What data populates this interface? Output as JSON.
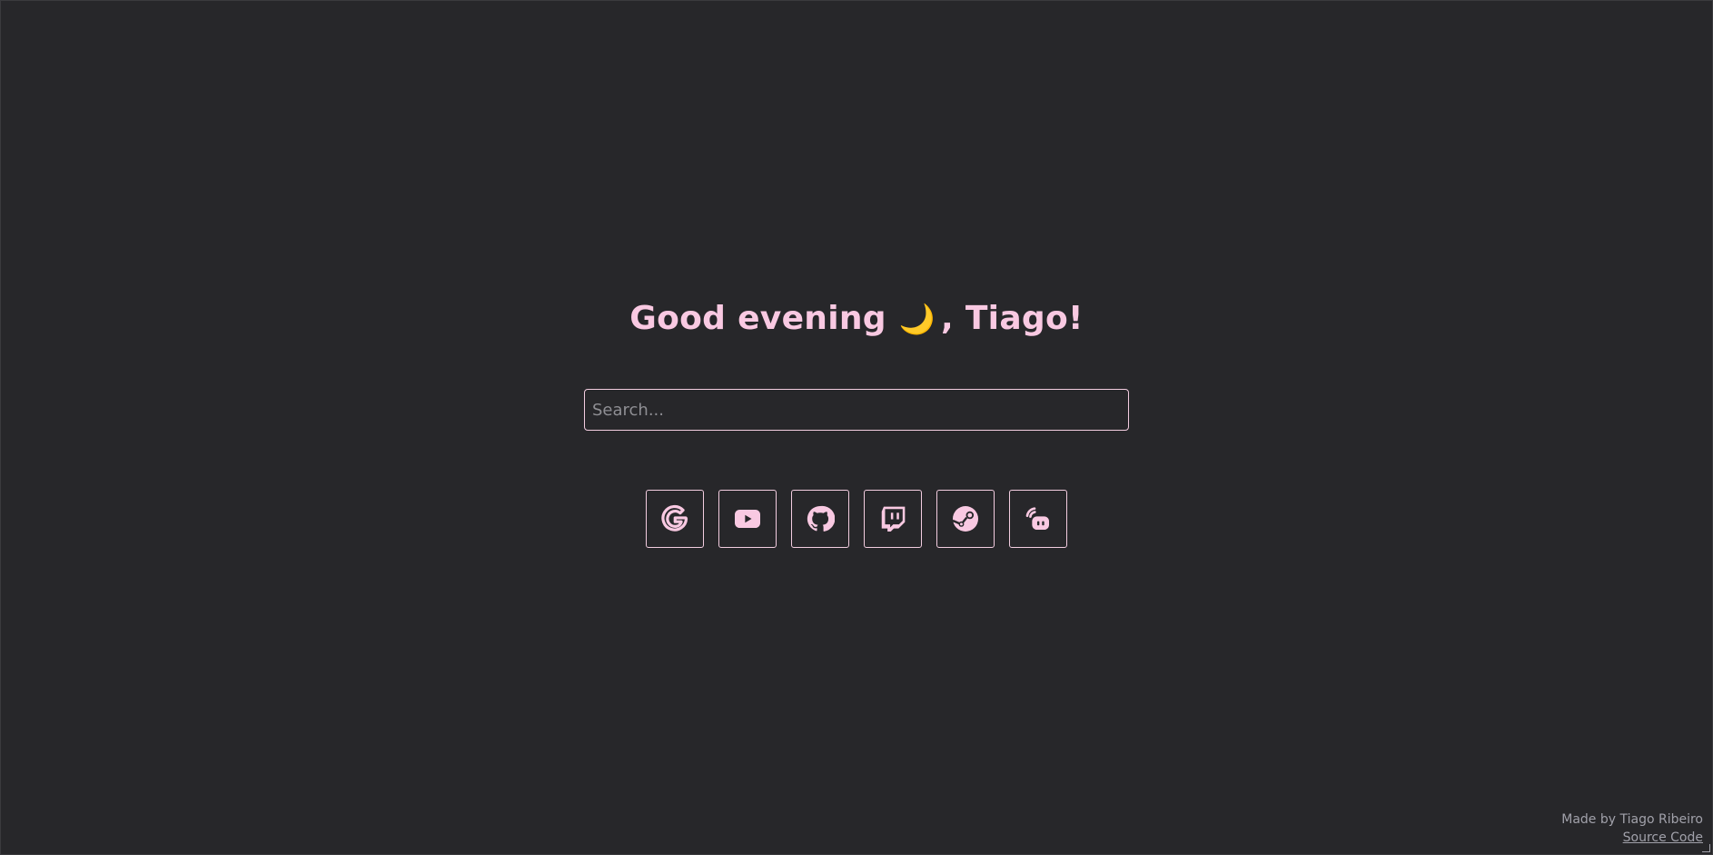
{
  "greeting": {
    "prefix": "Good evening",
    "emoji": "🌙",
    "suffix": ", Tiago!"
  },
  "search": {
    "placeholder": "Search...",
    "value": ""
  },
  "links": [
    {
      "name": "google",
      "icon": "google-icon"
    },
    {
      "name": "youtube",
      "icon": "youtube-icon"
    },
    {
      "name": "github",
      "icon": "github-icon"
    },
    {
      "name": "twitch",
      "icon": "twitch-icon"
    },
    {
      "name": "steam",
      "icon": "steam-icon"
    },
    {
      "name": "hardware",
      "icon": "hardware-icon"
    }
  ],
  "footer": {
    "credit": "Made by Tiago Ribeiro",
    "source_label": "Source Code"
  },
  "colors": {
    "background": "#27272a",
    "accent": "#f9c9e2",
    "border": "#f3cde0",
    "muted": "#a1a1aa"
  }
}
